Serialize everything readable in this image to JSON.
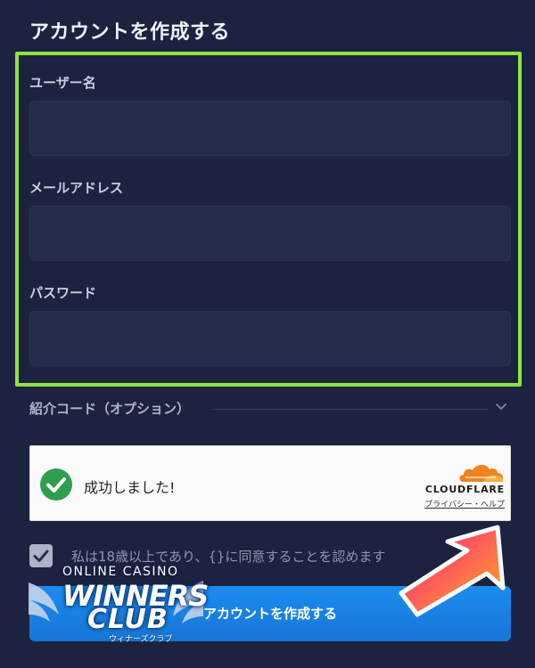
{
  "form": {
    "title": "アカウントを作成する",
    "username_label": "ユーザー名",
    "username_value": "",
    "email_label": "メールアドレス",
    "email_value": "",
    "password_label": "パスワード",
    "password_value": "",
    "referral_label": "紹介コード（オプション）",
    "agree_text": "私は18歳以上であり、{}に同意することを認めます",
    "agree_checked": true,
    "submit_label": "アカウントを作成する"
  },
  "captcha": {
    "status_text": "成功しました!",
    "provider": "CLOUDFLARE",
    "links": "プライバシー・ヘルプ"
  },
  "watermark": {
    "line1": "ONLINE CASINO",
    "line2": "WINNERS",
    "line3": "CLUB",
    "line4": "ウィナーズクラブ"
  },
  "colors": {
    "background": "#1c2340",
    "input_bg": "#242c4b",
    "highlight": "#8fe43e",
    "submit": "#1b8cf0",
    "success": "#2e9e4f",
    "cloudflare": "#f48120"
  },
  "icons": {
    "check": "check-circle-icon",
    "chevron": "chevron-down-icon",
    "cloud": "cloudflare-cloud-icon",
    "arrow": "pointing-arrow-icon"
  }
}
